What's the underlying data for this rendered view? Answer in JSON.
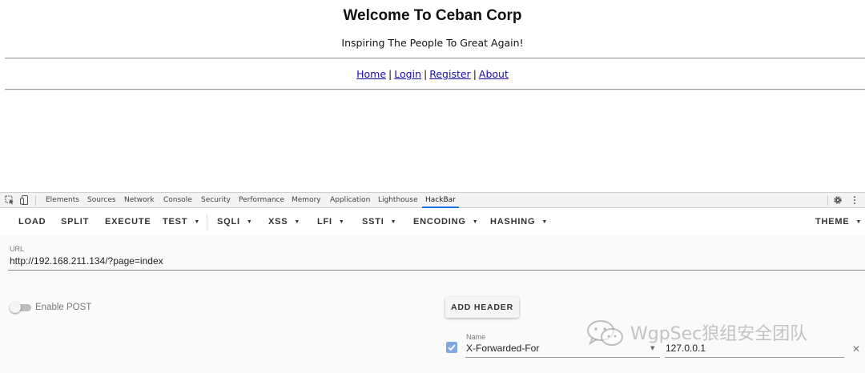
{
  "page": {
    "title": "Welcome To Ceban Corp",
    "subtitle": "Inspiring The People To Great Again!",
    "nav": [
      {
        "label": "Home"
      },
      {
        "label": "Login"
      },
      {
        "label": "Register"
      },
      {
        "label": "About"
      }
    ],
    "separator": "|",
    "link_color": "#1a0dab"
  },
  "devtools": {
    "tabs": [
      "Elements",
      "Sources",
      "Network",
      "Console",
      "Security",
      "Performance",
      "Memory",
      "Application",
      "Lighthouse",
      "HackBar"
    ],
    "active_tab": "HackBar",
    "accent": "#1a73e8",
    "icons": [
      "inspect-element-icon",
      "device-toggle-icon",
      "gear-icon",
      "kebab-menu-icon"
    ]
  },
  "hackbar": {
    "toolbar": {
      "load": "LOAD",
      "split": "SPLIT",
      "execute": "EXECUTE",
      "test": "TEST",
      "sqli": "SQLI",
      "xss": "XSS",
      "lfi": "LFI",
      "ssti": "SSTI",
      "encoding": "ENCODING",
      "hashing": "HASHING",
      "theme": "THEME"
    },
    "url_label": "URL",
    "url_value": "http://192.168.211.134/?page=index",
    "enable_post_label": "Enable POST",
    "enable_post": false,
    "add_header_label": "ADD HEADER",
    "header": {
      "enabled": true,
      "name_label": "Name",
      "name_value": "X-Forwarded-For",
      "value": "127.0.0.1"
    },
    "checkbox_color": "#7fa7e6"
  },
  "watermark": {
    "text": "WgpSec狼组安全团队"
  }
}
